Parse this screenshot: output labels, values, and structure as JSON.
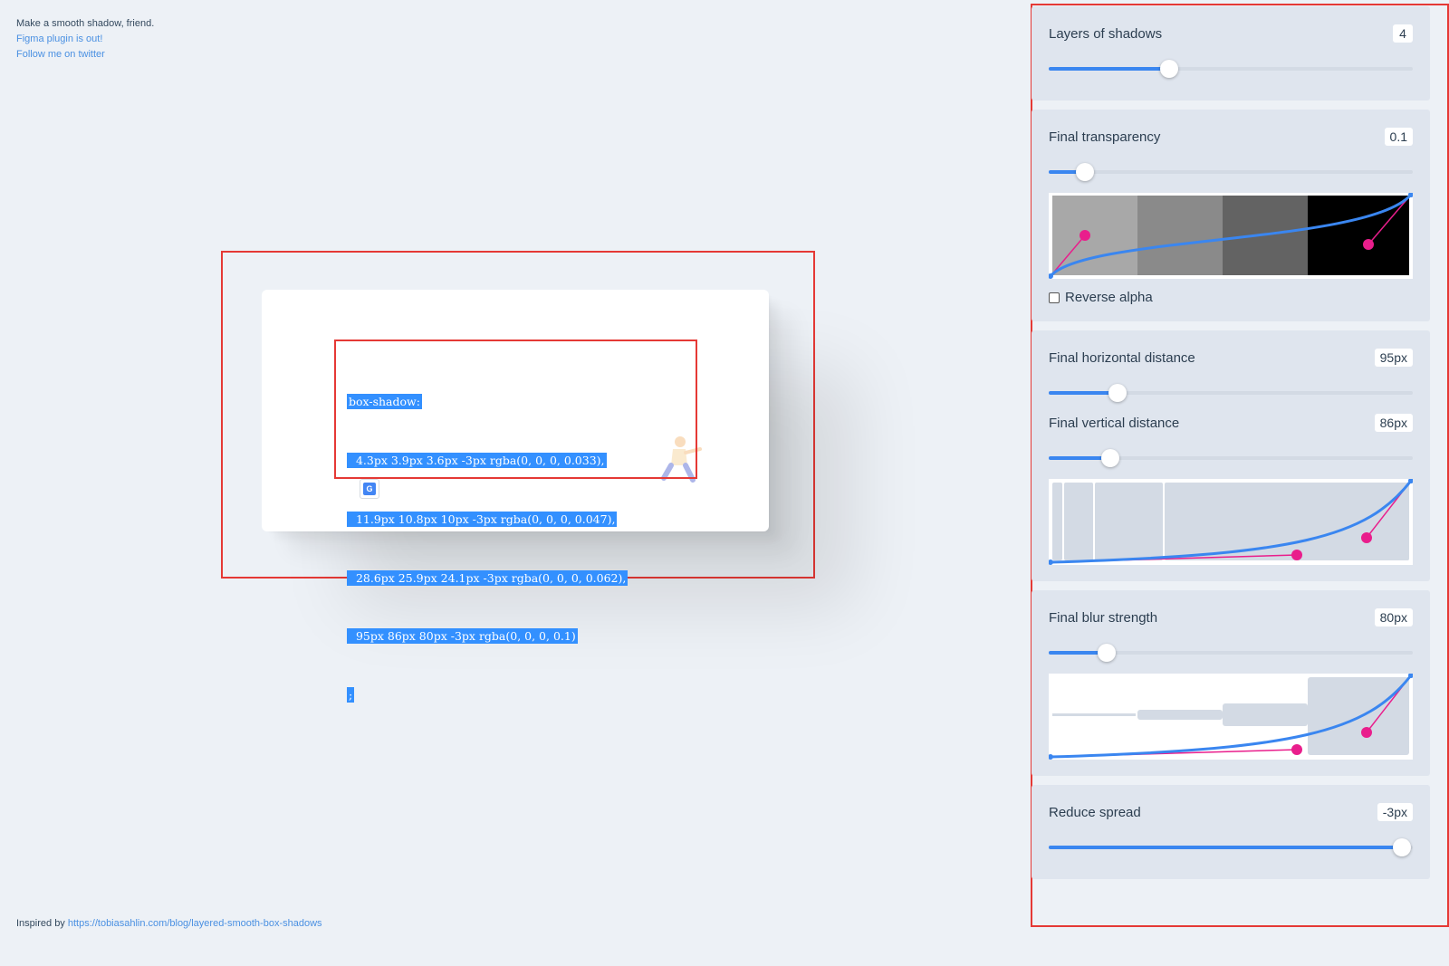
{
  "header": {
    "tagline": "Make a smooth shadow, friend.",
    "figma_link": "Figma plugin is out!",
    "twitter_link": "Follow me on twitter"
  },
  "footer": {
    "prefix": "Inspired by",
    "link": "https://tobiasahlin.com/blog/layered-smooth-box-shadows"
  },
  "code": {
    "lines": [
      "box-shadow:",
      "  4.3px 3.9px 3.6px -3px rgba(0, 0, 0, 0.033),",
      "  11.9px 10.8px 10px -3px rgba(0, 0, 0, 0.047),",
      "  28.6px 25.9px 24.1px -3px rgba(0, 0, 0, 0.062),",
      "  95px 86px 80px -3px rgba(0, 0, 0, 0.1)",
      ";"
    ]
  },
  "controls": {
    "layers": {
      "label": "Layers of shadows",
      "value": "4",
      "level": 0.33
    },
    "transparency": {
      "label": "Final transparency",
      "value": "0.1",
      "level": 0.1
    },
    "reverse_alpha": {
      "label": "Reverse alpha",
      "checked": false
    },
    "horizontal": {
      "label": "Final horizontal distance",
      "value": "95px",
      "level": 0.19
    },
    "vertical": {
      "label": "Final vertical distance",
      "value": "86px",
      "level": 0.17
    },
    "blur": {
      "label": "Final blur strength",
      "value": "80px",
      "level": 0.16
    },
    "spread": {
      "label": "Reduce spread",
      "value": "-3px",
      "level": 0.97
    }
  },
  "colors": {
    "accent": "#3a86f0",
    "handle": "#e91e8c",
    "selection": "#3390ff",
    "frame": "#e53935"
  }
}
